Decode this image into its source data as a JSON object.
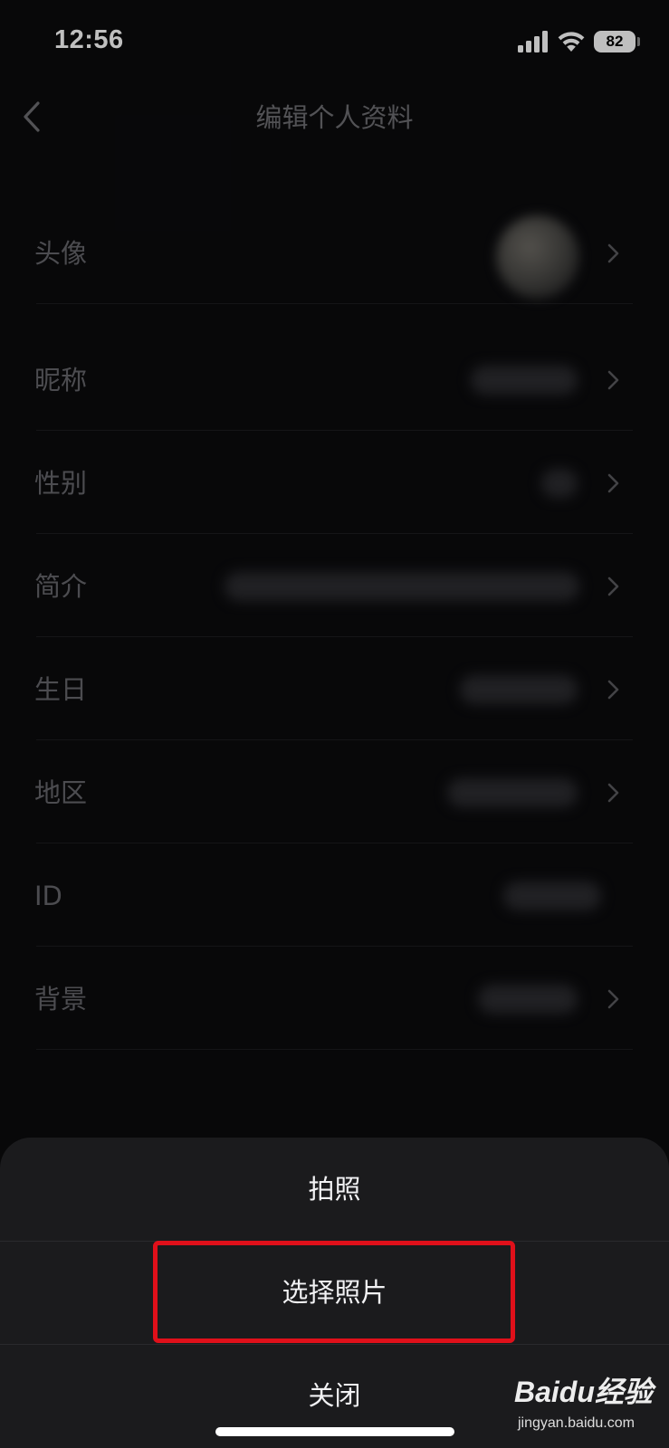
{
  "status_bar": {
    "time": "12:56",
    "battery_level": "82",
    "icons": [
      "signal-icon",
      "wifi-icon",
      "battery-icon"
    ]
  },
  "nav": {
    "title": "编辑个人资料",
    "back_icon": "chevron-left-icon"
  },
  "profile_rows": [
    {
      "label": "头像",
      "value_type": "avatar",
      "has_chevron": true
    },
    {
      "label": "昵称",
      "value_type": "blurred-text",
      "has_chevron": true
    },
    {
      "label": "性别",
      "value_type": "blurred-text",
      "has_chevron": true
    },
    {
      "label": "简介",
      "value_type": "blurred-text",
      "has_chevron": true
    },
    {
      "label": "生日",
      "value_type": "blurred-text",
      "has_chevron": true
    },
    {
      "label": "地区",
      "value_type": "blurred-text",
      "has_chevron": true
    },
    {
      "label": "ID",
      "value_type": "blurred-text",
      "has_chevron": false
    },
    {
      "label": "背景",
      "value_type": "blurred-text",
      "has_chevron": true
    }
  ],
  "action_sheet": {
    "options": [
      {
        "label": "拍照"
      },
      {
        "label": "选择照片",
        "highlighted": true
      },
      {
        "label": "关闭"
      }
    ],
    "highlight_color": "#e0101a"
  },
  "watermark": {
    "brand": "Baidu经验",
    "url": "jingyan.baidu.com"
  },
  "colors": {
    "background": "#0b0b0d",
    "sheet_background": "#1b1b1d",
    "label_text": "#66666b"
  }
}
